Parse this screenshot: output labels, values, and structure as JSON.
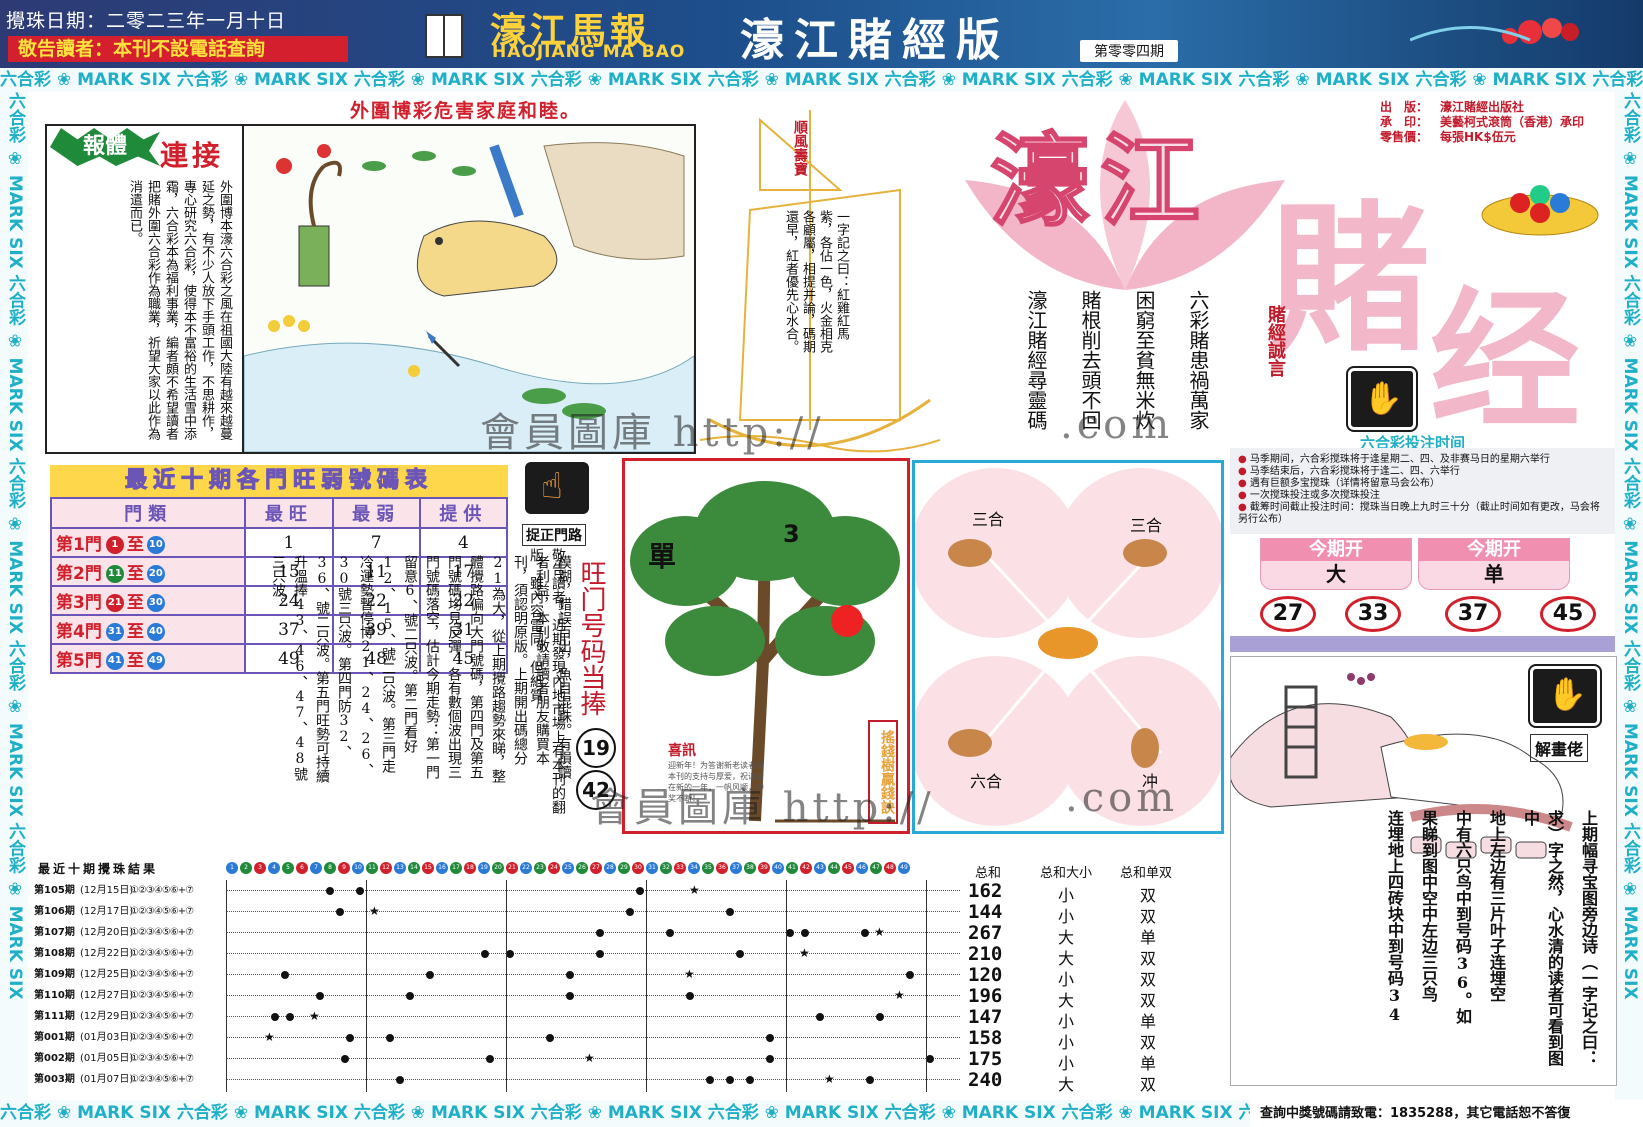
{
  "header": {
    "date": "攪珠日期：二零二三年一月十日",
    "notice": "敬告讀者：本刊不設電話查詢",
    "paper_cn": "濠江馬報",
    "paper_en": "HAOJIANG MA BAO",
    "edition": "濠江賭經版",
    "issue": "第零零四期"
  },
  "strip_text": "六合彩 ❀ MARK SIX 六合彩 ❀ MARK SIX 六合彩 ❀ MARK SIX 六合彩 ❀ MARK SIX 六合彩 ❀ MARK SIX 六合彩 ❀ MARK SIX 六合彩 ❀ MARK SIX 六合彩 ❀ MARK SIX 六合彩 ❀ MARK SIX 六合彩 ❀ MARK SIX",
  "strip_side": "六合彩 ❀ MARK SIX 六合彩 ❀ MARK SIX 六合彩 ❀ MARK SIX 六合彩 ❀ MARK SIX 六合彩 ❀ MARK SIX",
  "headline": "外圍博彩危害家庭和睦。",
  "story": {
    "badge": "報體",
    "title": "連接",
    "text": "外圍博本濠六合彩之風在祖國大陸有越來越蔓延之勢，有不少人放下手頭工作，不思耕作，專心研究六合彩，使得本不富裕的生活雪中添霜，六合彩本為福利事業，編者頗不希望讀者把賭外圍六合彩作為職業，祈望大家以此作為消遣而已。"
  },
  "ship": {
    "flag": "順風壽寶",
    "poem": "一字記之曰：紅雞紅馬紫，各佔一色，火金相克各顧屬，相提并論，碼期還早，紅者優先心水合。"
  },
  "center_poem": [
    "六彩賭患禍萬家",
    "困窮至貧無米炊",
    "賭根削去頭不回",
    "濠江賭經尋靈碼"
  ],
  "masthead": {
    "part1": "濠江",
    "part2": "賭",
    "part3": "经",
    "motto": "賭經誠言"
  },
  "pub_info": [
    {
      "k": "出　版：",
      "v": "濠江賭經出版社"
    },
    {
      "k": "承　印：",
      "v": "美藝柯式滾筒（香港）承印"
    },
    {
      "k": "零售價：",
      "v": "每張HK$伍元"
    }
  ],
  "bet_time": {
    "title": "六合彩投注时间",
    "items": [
      "马季期间，六合彩搅珠将于逢星期二、四、及非赛马日的星期六举行",
      "马季结束后，六合彩搅珠将于逢二、四、六举行",
      "遇有巨额多宝搅珠（详情将留意马会公布）",
      "一次搅珠投注或多次搅珠投注",
      "截筹时间截止投注时间：搅珠当日晚上九时三十分（截止时间如有更改，马会将另行公布）"
    ],
    "open_label": "今期开",
    "open_values": [
      "大",
      "单"
    ],
    "numbers": [
      "27",
      "33",
      "37",
      "45"
    ]
  },
  "stats": {
    "title": "最近十期各門旺弱號碼表",
    "headers": [
      "門類",
      "最旺",
      "最弱",
      "提供"
    ],
    "rows": [
      {
        "gate": "第1門",
        "from": "1",
        "to": "10",
        "hot": "1",
        "cold": "7",
        "tip": "4"
      },
      {
        "gate": "第2門",
        "from": "11",
        "to": "20",
        "hot": "15",
        "cold": "11",
        "tip": "17"
      },
      {
        "gate": "第3門",
        "from": "21",
        "to": "30",
        "hot": "24",
        "cold": "22",
        "tip": "22"
      },
      {
        "gate": "第4門",
        "from": "31",
        "to": "40",
        "hot": "37",
        "cold": "39",
        "tip": "31"
      },
      {
        "gate": "第5門",
        "from": "41",
        "to": "49",
        "hot": "49",
        "cold": "48",
        "tip": "45"
      }
    ],
    "to_word": "至"
  },
  "hint": {
    "label": "捉正門路",
    "note": "敬告讀者：近期發現內地市場上有本刊的翻版，雖內容雷同，但紙質",
    "wang_title": "旺门号码当捧",
    "nums": [
      "19",
      "42"
    ]
  },
  "analysis": "模糊，錯誤百出，魚目混珠。有損讀者利益，本刊敬請讀者朋友購買本刊，須認明原版。上期開出碼總分21為大，從上期攪路趨勢來睇，整體攪路偏向大門號碼，第四門及第五門號碼均見反彈，各有數個波出現三門號碼落空，估計今期走勢：第一門留意6、號二只波。第二門看好12、15、號二只波。第三門走冷運勢暫停博21、24、26、30號三只波。第四門防32、36、號二只波。第五門旺勢可持續升溫捧43、46、47、48號三只波。",
  "tree": {
    "dan": "單",
    "num": "3",
    "news_title": "喜訊",
    "news_text": "迎新年！为答谢新老读者对本刊的支持与厚爱，祝读者在新的一年，一帆风顺，中奖不断！",
    "side": "搖錢樹贏錢訣"
  },
  "zodiac": {
    "tl": "三合",
    "tr": "三合",
    "bl": "六合",
    "br": "冲"
  },
  "riddle": {
    "label": "解畫佬",
    "text": [
      "上期幅寻宝图旁边诗（一字记之曰：",
      "求）字之然，心水清的读者可看到图中",
      "地上左边有三片叶子连埋空",
      "中有六只鸟中到号码36。如",
      "果睇到图中空中左边三只鸟",
      "连埋地上四砖块中到号码34"
    ]
  },
  "draw": {
    "title": "最近十期攪珠結果",
    "head_sum": "总和",
    "head_size": "总和大小",
    "head_odd": "总和单双",
    "rows": [
      {
        "issue": "第105期",
        "date": "(12月15日)",
        "sum": "162",
        "size": "小",
        "odd": "双"
      },
      {
        "issue": "第106期",
        "date": "(12月17日)",
        "sum": "144",
        "size": "小",
        "odd": "双"
      },
      {
        "issue": "第107期",
        "date": "(12月20日)",
        "sum": "267",
        "size": "大",
        "odd": "单"
      },
      {
        "issue": "第108期",
        "date": "(12月22日)",
        "sum": "210",
        "size": "大",
        "odd": "双"
      },
      {
        "issue": "第109期",
        "date": "(12月25日)",
        "sum": "120",
        "size": "小",
        "odd": "双"
      },
      {
        "issue": "第110期",
        "date": "(12月27日)",
        "sum": "196",
        "size": "大",
        "odd": "双"
      },
      {
        "issue": "第111期",
        "date": "(12月29日)",
        "sum": "147",
        "size": "小",
        "odd": "单"
      },
      {
        "issue": "第001期",
        "date": "(01月03日)",
        "sum": "158",
        "size": "小",
        "odd": "双"
      },
      {
        "issue": "第002期",
        "date": "(01月05日)",
        "sum": "175",
        "size": "小",
        "odd": "单"
      },
      {
        "issue": "第003期",
        "date": "(01月07日)",
        "sum": "240",
        "size": "大",
        "odd": "双"
      }
    ],
    "balls_text": "①②③④⑤⑥+⑦"
  },
  "contact": "查詢中獎號碼請致電：1835288，其它電話恕不答復",
  "watermarks": [
    "會員圖庫 http://",
    ".com",
    "會員圖庫 http://",
    ".com"
  ],
  "colors": {
    "red": "#d1202c",
    "purple": "#6b56b8",
    "cyan": "#1fb0c8",
    "pink": "#f2b7c8"
  }
}
